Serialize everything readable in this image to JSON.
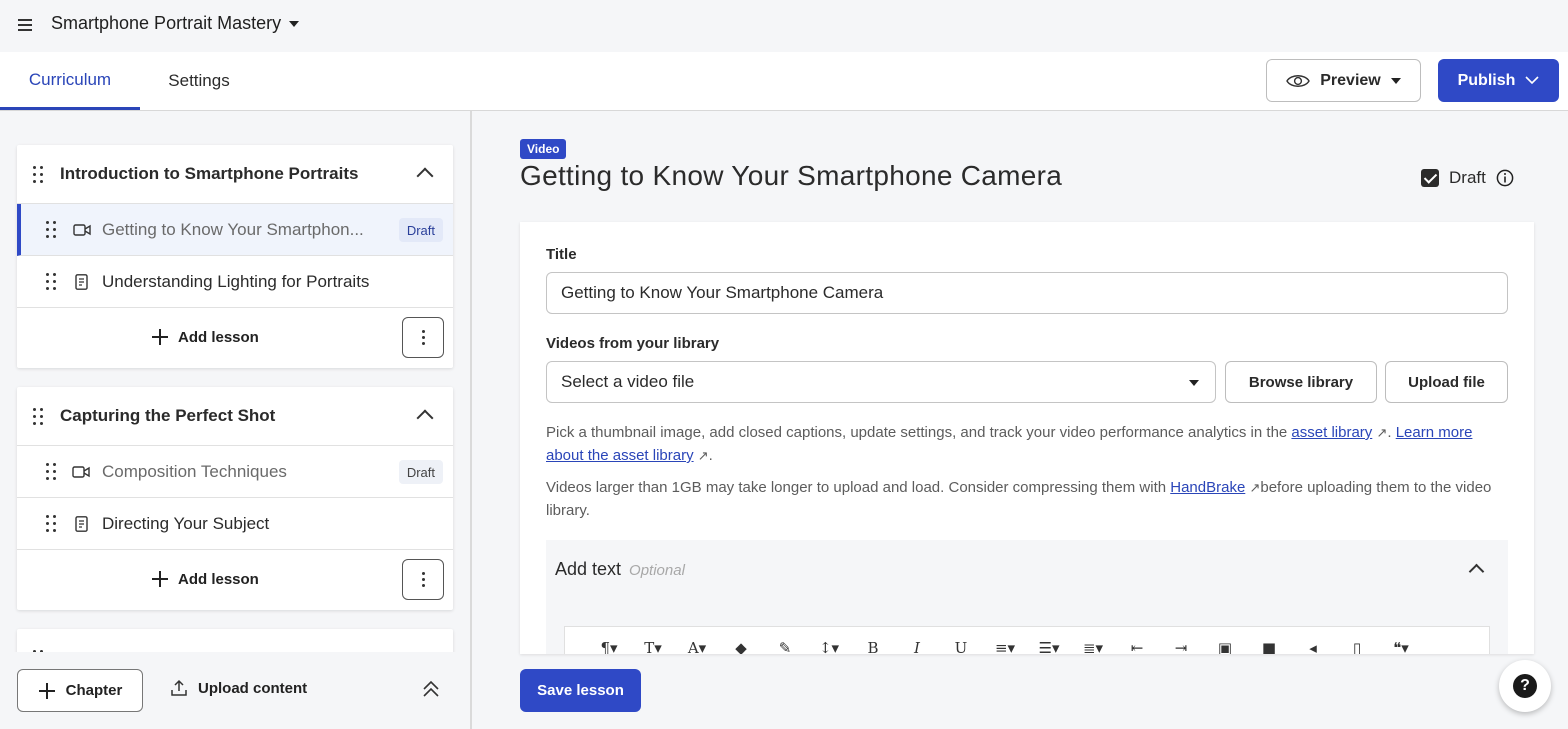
{
  "header": {
    "course_title": "Smartphone Portrait Mastery"
  },
  "tabs": [
    {
      "label": "Curriculum",
      "active": true
    },
    {
      "label": "Settings",
      "active": false
    }
  ],
  "actions": {
    "preview_label": "Preview",
    "publish_label": "Publish"
  },
  "chapters": [
    {
      "title": "Introduction to Smartphone Portraits",
      "lessons": [
        {
          "title": "Getting to Know Your Smartphon...",
          "type": "video",
          "badge": "Draft",
          "selected": true
        },
        {
          "title": "Understanding Lighting for Portraits",
          "type": "text",
          "badge": "",
          "selected": false
        }
      ],
      "add_label": "Add lesson"
    },
    {
      "title": "Capturing the Perfect Shot",
      "lessons": [
        {
          "title": "Composition Techniques",
          "type": "video",
          "badge": "Draft",
          "selected": false
        },
        {
          "title": "Directing Your Subject",
          "type": "text",
          "badge": "",
          "selected": false
        }
      ],
      "add_label": "Add lesson"
    }
  ],
  "left_footer": {
    "chapter_label": "Chapter",
    "upload_label": "Upload content"
  },
  "editor": {
    "type_tag": "Video",
    "heading": "Getting to Know Your Smartphone Camera",
    "draft_label": "Draft",
    "draft_checked": true,
    "title_label": "Title",
    "title_value": "Getting to Know Your Smartphone Camera",
    "library_label": "Videos from your library",
    "select_value": "Select a video file",
    "browse_label": "Browse library",
    "upload_label": "Upload file",
    "help1_text": "Pick a thumbnail image, add closed captions, update settings, and track your video performance analytics in the ",
    "help1_link1": "asset library",
    "help1_link2": "Learn more about the asset library",
    "help2_text": "Videos larger than 1GB may take longer to upload and load. Consider compressing them with ",
    "help2_link": "HandBrake",
    "help2_tail": "before uploading them to the video library.",
    "add_text_label": "Add text",
    "optional_label": "Optional",
    "save_label": "Save lesson"
  },
  "colors": {
    "accent": "#2f49c6",
    "background": "#f5f6f8"
  }
}
